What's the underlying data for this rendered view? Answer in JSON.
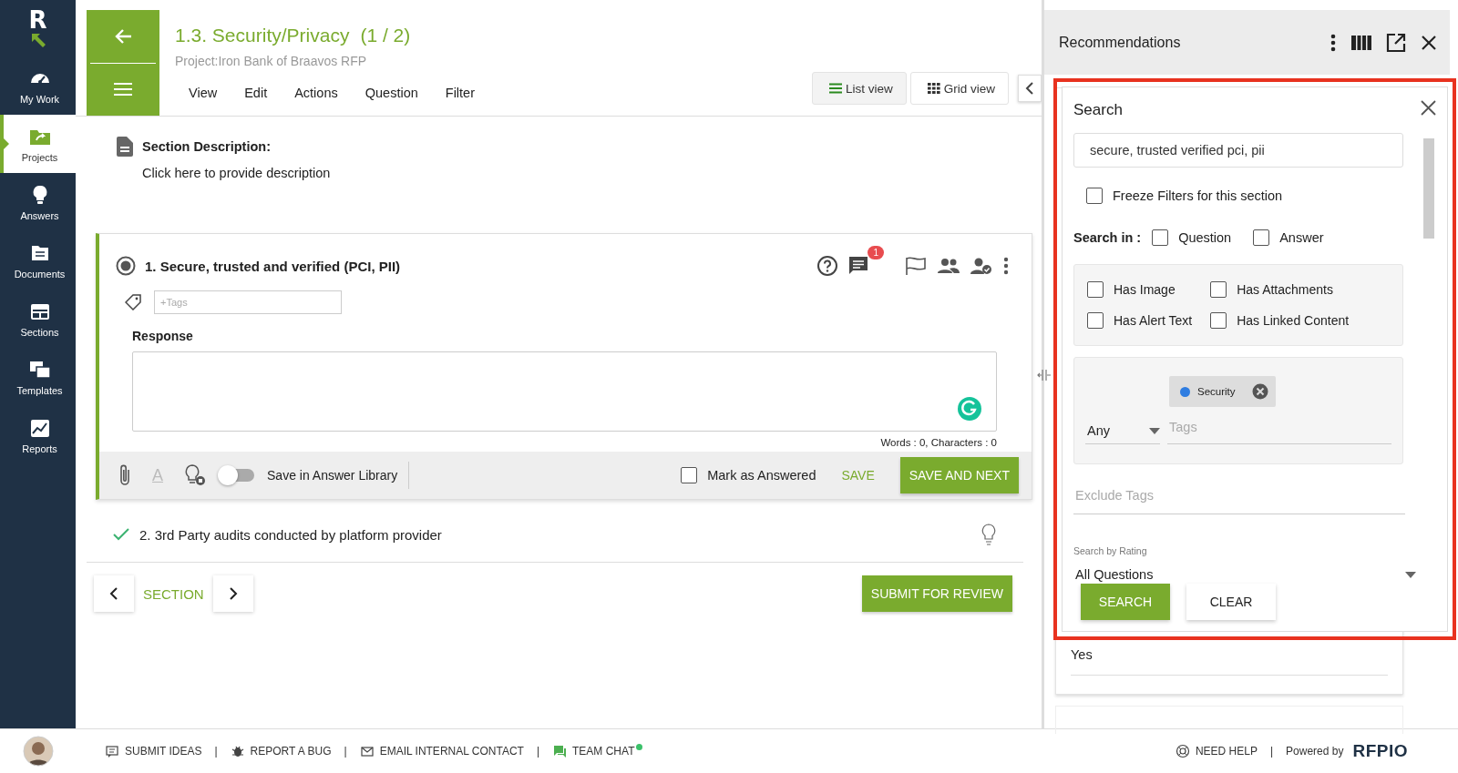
{
  "sidebar": {
    "brand_mark": "R",
    "items": [
      {
        "label": "My Work",
        "selected": false
      },
      {
        "label": "Projects",
        "selected": true
      },
      {
        "label": "Answers",
        "selected": false
      },
      {
        "label": "Documents",
        "selected": false
      },
      {
        "label": "Sections",
        "selected": false
      },
      {
        "label": "Templates",
        "selected": false
      },
      {
        "label": "Reports",
        "selected": false
      }
    ]
  },
  "header": {
    "title": "1.3. Security/Privacy",
    "count": "(1 / 2)",
    "project": "Project:Iron Bank of Braavos RFP",
    "menu": [
      "View",
      "Edit",
      "Actions",
      "Question",
      "Filter"
    ],
    "views": [
      {
        "label": "List view",
        "selected": true
      },
      {
        "label": "Grid view",
        "selected": false
      }
    ]
  },
  "section_description": {
    "label": "Section Description:",
    "text": "Click here to provide description"
  },
  "questions": [
    {
      "kind": "open",
      "title": "1. Secure, trusted and verified (PCI, PII)",
      "comment_count": "1",
      "tags_placeholder": "+Tags",
      "response_label": "Response",
      "counts": "Words : 0, Characters : 0",
      "format_glyph": "A",
      "library_toggle": {
        "label": "Save in Answer Library",
        "on": false
      },
      "mark_answered": {
        "label": "Mark as Answered",
        "checked": false
      },
      "save": "SAVE",
      "save_next": "SAVE AND NEXT"
    },
    {
      "kind": "closed",
      "title": "2. 3rd Party audits conducted by platform provider",
      "answered": true
    }
  ],
  "section_nav": {
    "label": "SECTION"
  },
  "submit": "SUBMIT FOR REVIEW",
  "recommendations": {
    "title": "Recommendations",
    "search": {
      "title": "Search",
      "value": "secure, trusted verified pci, pii",
      "freeze": {
        "label": "Freeze Filters for this section",
        "checked": false
      },
      "search_in_label": "Search in :",
      "search_in": [
        {
          "label": "Question",
          "checked": false
        },
        {
          "label": "Answer",
          "checked": false
        }
      ],
      "filters": [
        {
          "label": "Has Image",
          "checked": false
        },
        {
          "label": "Has Attachments",
          "checked": false
        },
        {
          "label": "Has Alert Text",
          "checked": false
        },
        {
          "label": "Has Linked Content",
          "checked": false
        }
      ],
      "tags": [
        {
          "label": "Security",
          "color": "#2f7de1"
        }
      ],
      "match": "Any",
      "tags_placeholder": "Tags",
      "exclude_placeholder": "Exclude Tags",
      "rating_label": "Search by Rating",
      "rating": "All Questions",
      "search_button": "SEARCH",
      "clear_button": "CLEAR"
    },
    "result": {
      "answer": "Yes"
    }
  },
  "footer": {
    "links": [
      {
        "label": "SUBMIT IDEAS",
        "online": false
      },
      {
        "separator": "|",
        "label": "REPORT A BUG",
        "online": false
      },
      {
        "separator": "|",
        "label": "EMAIL INTERNAL CONTACT",
        "online": false
      },
      {
        "separator": "|",
        "label": "TEAM CHAT",
        "online": true
      }
    ],
    "help": "NEED HELP",
    "help_separator": "|",
    "powered": "Powered by",
    "brand": "RFPIO"
  }
}
